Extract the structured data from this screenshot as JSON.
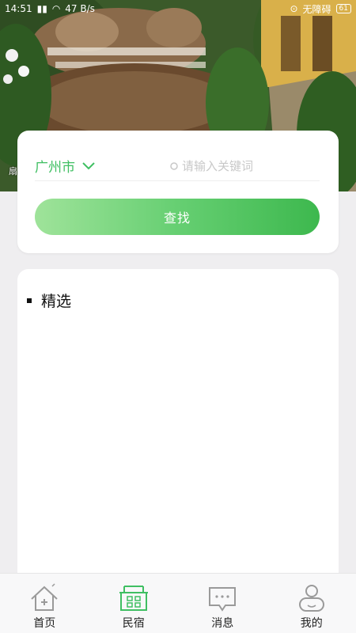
{
  "status_bar": {
    "time": "14:51",
    "network_speed": "47 B/s",
    "right_text": "无障碍",
    "battery": "61"
  },
  "banner": {
    "caption": "扇"
  },
  "search": {
    "city": "广州市",
    "placeholder": "请输入关键词",
    "button_label": "查找"
  },
  "featured": {
    "title": "精选"
  },
  "tabs": [
    {
      "label": "首页",
      "icon": "home-icon",
      "active": false
    },
    {
      "label": "民宿",
      "icon": "building-icon",
      "active": true
    },
    {
      "label": "消息",
      "icon": "message-icon",
      "active": false
    },
    {
      "label": "我的",
      "icon": "user-icon",
      "active": false
    }
  ],
  "colors": {
    "accent": "#3fbf62",
    "icon_inactive": "#9a9a9a"
  }
}
